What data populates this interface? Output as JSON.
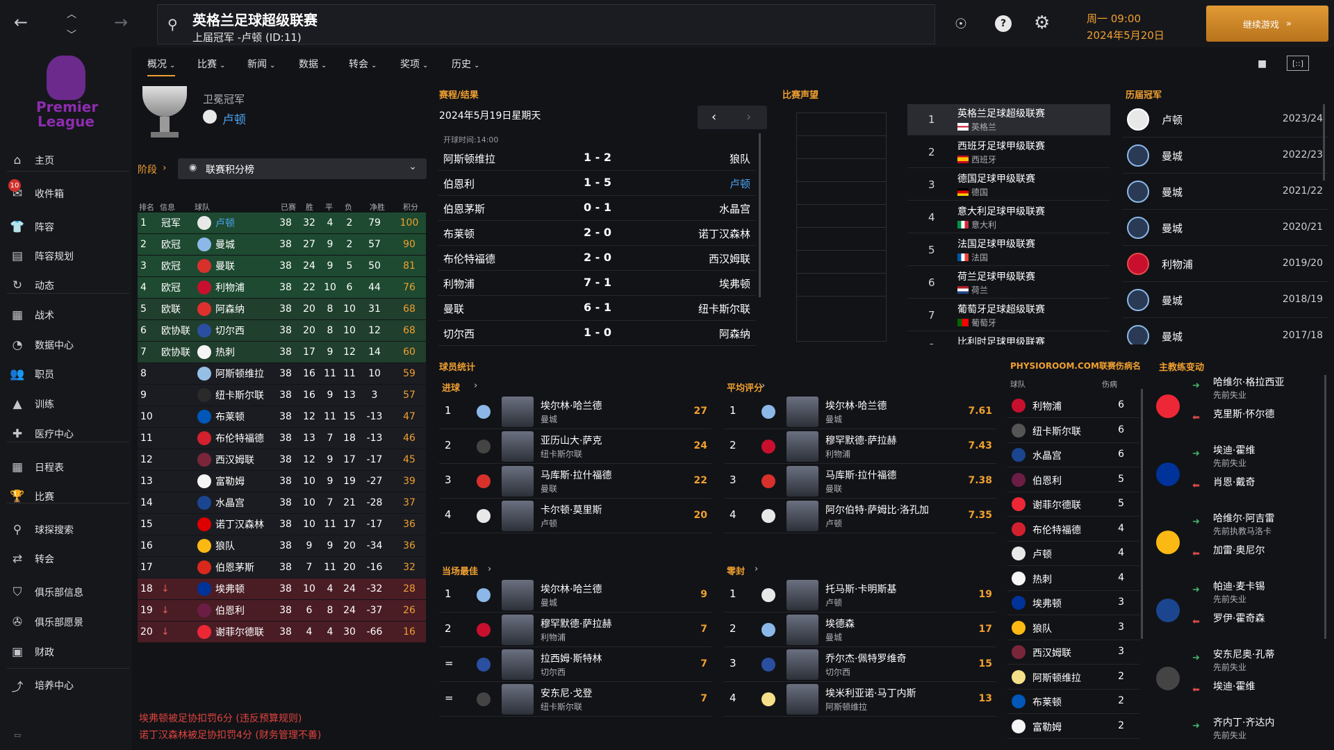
{
  "header": {
    "title": "英格兰足球超级联赛",
    "subtitle": "上届冠军 -卢顿 (ID:11)",
    "day_time": "周一 09:00",
    "date": "2024年5月20日",
    "continue_label": "继续游戏"
  },
  "logo": {
    "line1": "Premier",
    "line2": "League"
  },
  "sidebar": {
    "badge": "10",
    "items": [
      {
        "label": "主页",
        "icon": "home-icon"
      },
      {
        "label": "收件箱",
        "icon": "inbox-icon"
      },
      {
        "label": "阵容",
        "icon": "shirt-icon"
      },
      {
        "label": "阵容规划",
        "icon": "clipboard-icon"
      },
      {
        "label": "动态",
        "icon": "refresh-icon"
      },
      {
        "label": "战术",
        "icon": "tactics-icon"
      },
      {
        "label": "数据中心",
        "icon": "data-icon"
      },
      {
        "label": "职员",
        "icon": "staff-icon"
      },
      {
        "label": "训练",
        "icon": "training-icon"
      },
      {
        "label": "医疗中心",
        "icon": "medical-icon"
      },
      {
        "label": "日程表",
        "icon": "calendar-icon"
      },
      {
        "label": "比赛",
        "icon": "trophy-icon"
      },
      {
        "label": "球探搜索",
        "icon": "search-icon"
      },
      {
        "label": "转会",
        "icon": "transfer-icon"
      },
      {
        "label": "俱乐部信息",
        "icon": "shield-icon"
      },
      {
        "label": "俱乐部愿景",
        "icon": "vision-icon"
      },
      {
        "label": "财政",
        "icon": "finance-icon"
      },
      {
        "label": "培养中心",
        "icon": "growth-icon"
      }
    ]
  },
  "subnav": [
    "概况",
    "比赛",
    "新闻",
    "数据",
    "转会",
    "奖项",
    "历史"
  ],
  "defending": {
    "label": "卫冕冠军",
    "team": "卢顿"
  },
  "stage": {
    "label": "阶段",
    "dropdown": "联赛积分榜"
  },
  "standings": {
    "headers": [
      "排名",
      "信息",
      "球队",
      "已赛",
      "胜",
      "平",
      "负",
      "净胜",
      "积分"
    ],
    "rows": [
      {
        "pos": "1",
        "info": "冠军",
        "team": "卢顿",
        "p": "38",
        "w": "32",
        "d": "4",
        "l": "2",
        "gd": "79",
        "pts": "100",
        "zone": "green",
        "highlight": true
      },
      {
        "pos": "2",
        "info": "欧冠",
        "team": "曼城",
        "p": "38",
        "w": "27",
        "d": "9",
        "l": "2",
        "gd": "57",
        "pts": "90",
        "zone": "green"
      },
      {
        "pos": "3",
        "info": "欧冠",
        "team": "曼联",
        "p": "38",
        "w": "24",
        "d": "9",
        "l": "5",
        "gd": "50",
        "pts": "81",
        "zone": "green"
      },
      {
        "pos": "4",
        "info": "欧冠",
        "team": "利物浦",
        "p": "38",
        "w": "22",
        "d": "10",
        "l": "6",
        "gd": "44",
        "pts": "76",
        "zone": "green"
      },
      {
        "pos": "5",
        "info": "欧联",
        "team": "阿森纳",
        "p": "38",
        "w": "20",
        "d": "8",
        "l": "10",
        "gd": "31",
        "pts": "68",
        "zone": "green2"
      },
      {
        "pos": "6",
        "info": "欧协联",
        "team": "切尔西",
        "p": "38",
        "w": "20",
        "d": "8",
        "l": "10",
        "gd": "12",
        "pts": "68",
        "zone": "green2"
      },
      {
        "pos": "7",
        "info": "欧协联",
        "team": "热刺",
        "p": "38",
        "w": "17",
        "d": "9",
        "l": "12",
        "gd": "14",
        "pts": "60",
        "zone": "green2"
      },
      {
        "pos": "8",
        "info": "",
        "team": "阿斯顿维拉",
        "p": "38",
        "w": "16",
        "d": "11",
        "l": "11",
        "gd": "10",
        "pts": "59",
        "zone": "none"
      },
      {
        "pos": "9",
        "info": "",
        "team": "纽卡斯尔联",
        "p": "38",
        "w": "16",
        "d": "9",
        "l": "13",
        "gd": "3",
        "pts": "57",
        "zone": "none"
      },
      {
        "pos": "10",
        "info": "",
        "team": "布莱顿",
        "p": "38",
        "w": "12",
        "d": "11",
        "l": "15",
        "gd": "-13",
        "pts": "47",
        "zone": "none"
      },
      {
        "pos": "11",
        "info": "",
        "team": "布伦特福德",
        "p": "38",
        "w": "13",
        "d": "7",
        "l": "18",
        "gd": "-13",
        "pts": "46",
        "zone": "none"
      },
      {
        "pos": "12",
        "info": "",
        "team": "西汉姆联",
        "p": "38",
        "w": "12",
        "d": "9",
        "l": "17",
        "gd": "-17",
        "pts": "45",
        "zone": "none"
      },
      {
        "pos": "13",
        "info": "",
        "team": "富勒姆",
        "p": "38",
        "w": "10",
        "d": "9",
        "l": "19",
        "gd": "-27",
        "pts": "39",
        "zone": "none"
      },
      {
        "pos": "14",
        "info": "",
        "team": "水晶宫",
        "p": "38",
        "w": "10",
        "d": "7",
        "l": "21",
        "gd": "-28",
        "pts": "37",
        "zone": "none"
      },
      {
        "pos": "15",
        "info": "",
        "team": "诺丁汉森林",
        "p": "38",
        "w": "10",
        "d": "11",
        "l": "17",
        "gd": "-17",
        "pts": "36",
        "zone": "none"
      },
      {
        "pos": "16",
        "info": "",
        "team": "狼队",
        "p": "38",
        "w": "9",
        "d": "9",
        "l": "20",
        "gd": "-34",
        "pts": "36",
        "zone": "none"
      },
      {
        "pos": "17",
        "info": "",
        "team": "伯恩茅斯",
        "p": "38",
        "w": "7",
        "d": "11",
        "l": "20",
        "gd": "-16",
        "pts": "32",
        "zone": "none"
      },
      {
        "pos": "18",
        "info": "↓",
        "team": "埃弗顿",
        "p": "38",
        "w": "10",
        "d": "4",
        "l": "24",
        "gd": "-32",
        "pts": "28",
        "zone": "red"
      },
      {
        "pos": "19",
        "info": "↓",
        "team": "伯恩利",
        "p": "38",
        "w": "6",
        "d": "8",
        "l": "24",
        "gd": "-37",
        "pts": "26",
        "zone": "red"
      },
      {
        "pos": "20",
        "info": "↓",
        "team": "谢菲尔德联",
        "p": "38",
        "w": "4",
        "d": "4",
        "l": "30",
        "gd": "-66",
        "pts": "16",
        "zone": "red"
      }
    ]
  },
  "notes": [
    "埃弗顿被足协扣罚6分 (违反预算规则)",
    "诺丁汉森林被足协扣罚4分 (财务管理不善)"
  ],
  "fixtures": {
    "title": "赛程/结果",
    "date": "2024年5月19日星期天",
    "kickoff": "开球时间:14:00",
    "matches": [
      {
        "home": "阿斯顿维拉",
        "score": "1 - 2",
        "away": "狼队"
      },
      {
        "home": "伯恩利",
        "score": "1 - 5",
        "away": "卢顿",
        "away_blue": true
      },
      {
        "home": "伯恩茅斯",
        "score": "0 - 1",
        "away": "水晶宫"
      },
      {
        "home": "布莱顿",
        "score": "2 - 0",
        "away": "诺丁汉森林"
      },
      {
        "home": "布伦特福德",
        "score": "2 - 0",
        "away": "西汉姆联"
      },
      {
        "home": "利物浦",
        "score": "7 - 1",
        "away": "埃弗顿"
      },
      {
        "home": "曼联",
        "score": "6 - 1",
        "away": "纽卡斯尔联"
      },
      {
        "home": "切尔西",
        "score": "1 - 0",
        "away": "阿森纳"
      }
    ]
  },
  "reputation": {
    "title": "比赛声望",
    "leagues": [
      {
        "rank": "1",
        "name": "英格兰足球超级联赛",
        "country": "英格兰"
      },
      {
        "rank": "2",
        "name": "西班牙足球甲级联赛",
        "country": "西班牙"
      },
      {
        "rank": "3",
        "name": "德国足球甲级联赛",
        "country": "德国"
      },
      {
        "rank": "4",
        "name": "意大利足球甲级联赛",
        "country": "意大利"
      },
      {
        "rank": "5",
        "name": "法国足球甲级联赛",
        "country": "法国"
      },
      {
        "rank": "6",
        "name": "荷兰足球甲级联赛",
        "country": "荷兰"
      },
      {
        "rank": "7",
        "name": "葡萄牙足球超级联赛",
        "country": "葡萄牙"
      },
      {
        "rank": "8",
        "name": "比利时足球甲级联赛",
        "country": ""
      }
    ]
  },
  "champions": {
    "title": "历届冠军",
    "list": [
      {
        "team": "卢顿",
        "season": "2023/24"
      },
      {
        "team": "曼城",
        "season": "2022/23"
      },
      {
        "team": "曼城",
        "season": "2021/22"
      },
      {
        "team": "曼城",
        "season": "2020/21"
      },
      {
        "team": "利物浦",
        "season": "2019/20"
      },
      {
        "team": "曼城",
        "season": "2018/19"
      },
      {
        "team": "曼城",
        "season": "2017/18"
      }
    ]
  },
  "player_stats": {
    "title": "球员统计",
    "goals": {
      "title": "进球",
      "rows": [
        {
          "rank": "1",
          "name": "埃尔林·哈兰德",
          "team": "曼城",
          "value": "27"
        },
        {
          "rank": "2",
          "name": "亚历山大·萨克",
          "team": "纽卡斯尔联",
          "value": "24"
        },
        {
          "rank": "3",
          "name": "马库斯·拉什福德",
          "team": "曼联",
          "value": "22"
        },
        {
          "rank": "4",
          "name": "卡尔顿·莫里斯",
          "team": "卢顿",
          "value": "20",
          "blue": true
        }
      ]
    },
    "rating": {
      "title": "平均评分",
      "rows": [
        {
          "rank": "1",
          "name": "埃尔林·哈兰德",
          "team": "曼城",
          "value": "7.61"
        },
        {
          "rank": "2",
          "name": "穆罕默德·萨拉赫",
          "team": "利物浦",
          "value": "7.43"
        },
        {
          "rank": "3",
          "name": "马库斯·拉什福德",
          "team": "曼联",
          "value": "7.38"
        },
        {
          "rank": "4",
          "name": "阿尔伯特·萨姆比·洛孔加",
          "team": "卢顿",
          "value": "7.35",
          "blue": true
        }
      ]
    },
    "motm": {
      "title": "当场最佳",
      "rows": [
        {
          "rank": "1",
          "name": "埃尔林·哈兰德",
          "team": "曼城",
          "value": "9"
        },
        {
          "rank": "2",
          "name": "穆罕默德·萨拉赫",
          "team": "利物浦",
          "value": "7"
        },
        {
          "rank": "=",
          "name": "拉西姆·斯特林",
          "team": "切尔西",
          "value": "7"
        },
        {
          "rank": "=",
          "name": "安东尼·戈登",
          "team": "纽卡斯尔联",
          "value": "7"
        }
      ]
    },
    "clean": {
      "title": "零封",
      "rows": [
        {
          "rank": "1",
          "name": "托马斯·卡明斯基",
          "team": "卢顿",
          "value": "19",
          "blue": true
        },
        {
          "rank": "2",
          "name": "埃德森",
          "team": "曼城",
          "value": "17"
        },
        {
          "rank": "3",
          "name": "乔尔杰·佩特罗维奇",
          "team": "切尔西",
          "value": "15"
        },
        {
          "rank": "4",
          "name": "埃米利亚诺·马丁内斯",
          "team": "阿斯顿维拉",
          "value": "13"
        }
      ]
    }
  },
  "injuries": {
    "title": "PHYSIOROOM.COM联赛伤病名",
    "col_team": "球队",
    "col_inj": "伤病",
    "rows": [
      {
        "team": "利物浦",
        "n": "6"
      },
      {
        "team": "纽卡斯尔联",
        "n": "6"
      },
      {
        "team": "水晶宫",
        "n": "6"
      },
      {
        "team": "伯恩利",
        "n": "5"
      },
      {
        "team": "谢菲尔德联",
        "n": "5"
      },
      {
        "team": "布伦特福德",
        "n": "4"
      },
      {
        "team": "卢顿",
        "n": "4",
        "blue": true
      },
      {
        "team": "热刺",
        "n": "4"
      },
      {
        "team": "埃弗顿",
        "n": "3"
      },
      {
        "team": "狼队",
        "n": "3"
      },
      {
        "team": "西汉姆联",
        "n": "3"
      },
      {
        "team": "阿斯顿维拉",
        "n": "2"
      },
      {
        "team": "布莱顿",
        "n": "2"
      },
      {
        "team": "富勒姆",
        "n": "2"
      }
    ]
  },
  "managers": {
    "title": "主教练变动",
    "rows": [
      {
        "in": "哈维尔·格拉西亚",
        "in_sub": "先前失业",
        "out": "克里斯·怀尔德"
      },
      {
        "in": "埃迪·霍维",
        "in_sub": "先前失业",
        "out": "肖恩·戴奇"
      },
      {
        "in": "哈维尔·阿吉雷",
        "in_sub": "先前执教马洛卡",
        "out": "加雷·奥尼尔"
      },
      {
        "in": "帕迪·麦卡锡",
        "in_sub": "先前失业",
        "out": "罗伊·霍奇森"
      },
      {
        "in": "安东尼奥·孔蒂",
        "in_sub": "先前失业",
        "out": "埃迪·霍维"
      },
      {
        "in": "齐内丁·齐达内",
        "in_sub": "先前失业",
        "out": ""
      }
    ]
  },
  "colors": {
    "accent": "#f0a030",
    "blue": "#4aa3f0",
    "green": "#1f5a3a",
    "red": "#5a1f28"
  }
}
